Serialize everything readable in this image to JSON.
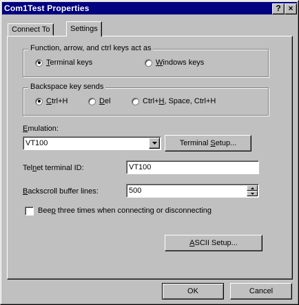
{
  "window": {
    "title": "Com1Test Properties",
    "help_glyph": "?",
    "close_glyph": "×"
  },
  "tabs": [
    {
      "label": "Connect To"
    },
    {
      "label": "Settings"
    }
  ],
  "keys_group": {
    "title": "Function, arrow, and ctrl keys act as",
    "options": [
      {
        "pre": "",
        "accel": "T",
        "post": "erminal keys",
        "selected": true
      },
      {
        "pre": "",
        "accel": "W",
        "post": "indows keys",
        "selected": false
      }
    ]
  },
  "backspace_group": {
    "title": "Backspace key sends",
    "options": [
      {
        "pre": "",
        "accel": "C",
        "post": "trl+H",
        "selected": true
      },
      {
        "pre": "",
        "accel": "D",
        "post": "el",
        "selected": false
      },
      {
        "pre": "Ctrl+",
        "accel": "H",
        "post": ", Space, Ctrl+H",
        "selected": false
      }
    ]
  },
  "emulation": {
    "label_accel": "E",
    "label_rest": "mulation:",
    "value": "VT100"
  },
  "terminal_setup_button": {
    "pre": "Terminal ",
    "accel": "S",
    "post": "etup..."
  },
  "telnet": {
    "label_pre": "Tel",
    "label_accel": "n",
    "label_post": "et terminal ID:",
    "value": "VT100"
  },
  "backscroll": {
    "label_accel": "B",
    "label_rest": "ackscroll buffer lines:",
    "value": "500"
  },
  "beep": {
    "pre": "Bee",
    "accel": "p",
    "post": " three times when connecting or disconnecting",
    "checked": false
  },
  "ascii_button": {
    "pre": "",
    "accel": "A",
    "post": "SCII Setup..."
  },
  "footer": {
    "ok": "OK",
    "cancel": "Cancel"
  }
}
